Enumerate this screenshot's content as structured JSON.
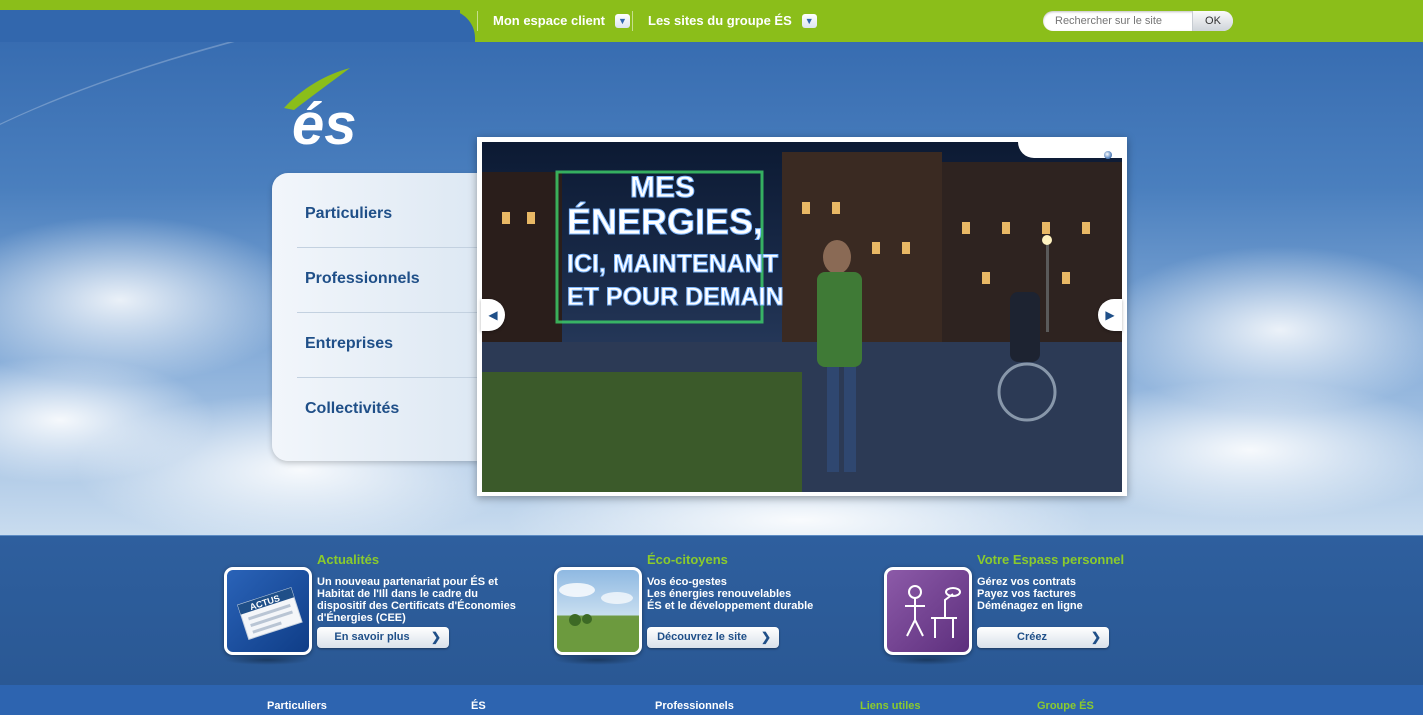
{
  "topnav": {
    "client": "Mon espace client",
    "group_sites": "Les sites du groupe ÉS",
    "search_placeholder": "Rechercher sur le site",
    "search_button": "OK"
  },
  "logo": {
    "text": "és",
    "icon": "es-logo"
  },
  "menu": {
    "items": [
      {
        "label": "Particuliers"
      },
      {
        "label": "Professionnels"
      },
      {
        "label": "Entreprises"
      },
      {
        "label": "Collectivités"
      }
    ]
  },
  "slider": {
    "headline_lines": [
      "MES",
      "ÉNERGIES,",
      "ICI, MAINTENANT",
      "ET POUR DEMAIN"
    ],
    "prev_icon": "chevron-left-icon",
    "next_icon": "chevron-right-icon"
  },
  "features": [
    {
      "title": "Actualités",
      "lines": [
        "Un nouveau partenariat pour ÉS et Habitat de l'Ill dans le cadre du dispositif des Certificats d'Économies d'Énergies (CEE)"
      ],
      "button": "En savoir plus",
      "thumb_label": "ACTUS"
    },
    {
      "title": "Éco-citoyens",
      "lines": [
        "Vos éco-gestes",
        "Les énergies renouvelables",
        "ÉS et le développement durable"
      ],
      "button": "Découvrez le site"
    },
    {
      "title": "Votre Espass personnel",
      "lines": [
        "Gérez vos contrats",
        "Payez vos factures",
        "Déménagez en ligne"
      ],
      "button": "Créez"
    }
  ],
  "footer": {
    "columns": [
      {
        "label": "Particuliers",
        "color": "#ffffff"
      },
      {
        "label": "ÉS",
        "color": "#ffffff"
      },
      {
        "label": "Professionnels",
        "color": "#ffffff"
      },
      {
        "label": "Liens utiles",
        "color": "#8bcb2c"
      },
      {
        "label": "Groupe ÉS",
        "color": "#8bcb2c"
      }
    ]
  },
  "colors": {
    "brand_green": "#8bbe1a",
    "brand_blue": "#3267ad",
    "text_blue": "#1f4f88"
  }
}
